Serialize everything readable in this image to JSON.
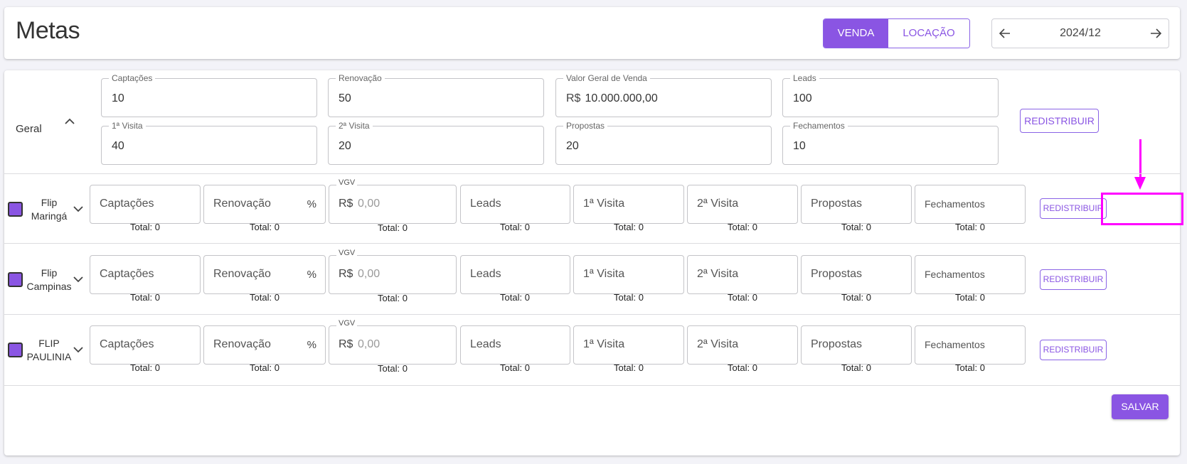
{
  "header": {
    "title": "Metas",
    "tabs": [
      {
        "label": "VENDA",
        "active": true
      },
      {
        "label": "LOCAÇÃO",
        "active": false
      }
    ],
    "period": "2024/12"
  },
  "geral": {
    "label": "Geral",
    "fields": [
      {
        "label": "Captações",
        "value": "10"
      },
      {
        "label": "Renovação",
        "value": "50"
      },
      {
        "label": "Valor Geral de Venda",
        "prefix": "R$",
        "value": "10.000.000,00"
      },
      {
        "label": "Leads",
        "value": "100"
      },
      {
        "label": "1ª Visita",
        "value": "40"
      },
      {
        "label": "2ª Visita",
        "value": "20"
      },
      {
        "label": "Propostas",
        "value": "20"
      },
      {
        "label": "Fechamentos",
        "value": "10"
      }
    ],
    "redistribute_label": "REDISTRIBUIR"
  },
  "rows": [
    {
      "name_line1": "Flip",
      "name_line2": "Maringá",
      "checked": true
    },
    {
      "name_line1": "Flip",
      "name_line2": "Campinas",
      "checked": true
    },
    {
      "name_line1": "FLIP",
      "name_line2": "PAULINIA",
      "checked": true
    }
  ],
  "row_fields": {
    "captacoes": "Captações",
    "renovacao": "Renovação",
    "percent": "%",
    "vgv_label": "VGV",
    "vgv_prefix": "R$",
    "vgv_placeholder": "0,00",
    "leads": "Leads",
    "visita1": "1ª Visita",
    "visita2": "2ª Visita",
    "propostas": "Propostas",
    "fechamentos": "Fechamentos",
    "total": "Total: 0",
    "redistribute": "REDISTRIBUIR"
  },
  "footer": {
    "save_label": "SALVAR"
  },
  "colors": {
    "accent": "#8a55e3",
    "highlight": "#ff00ff"
  }
}
